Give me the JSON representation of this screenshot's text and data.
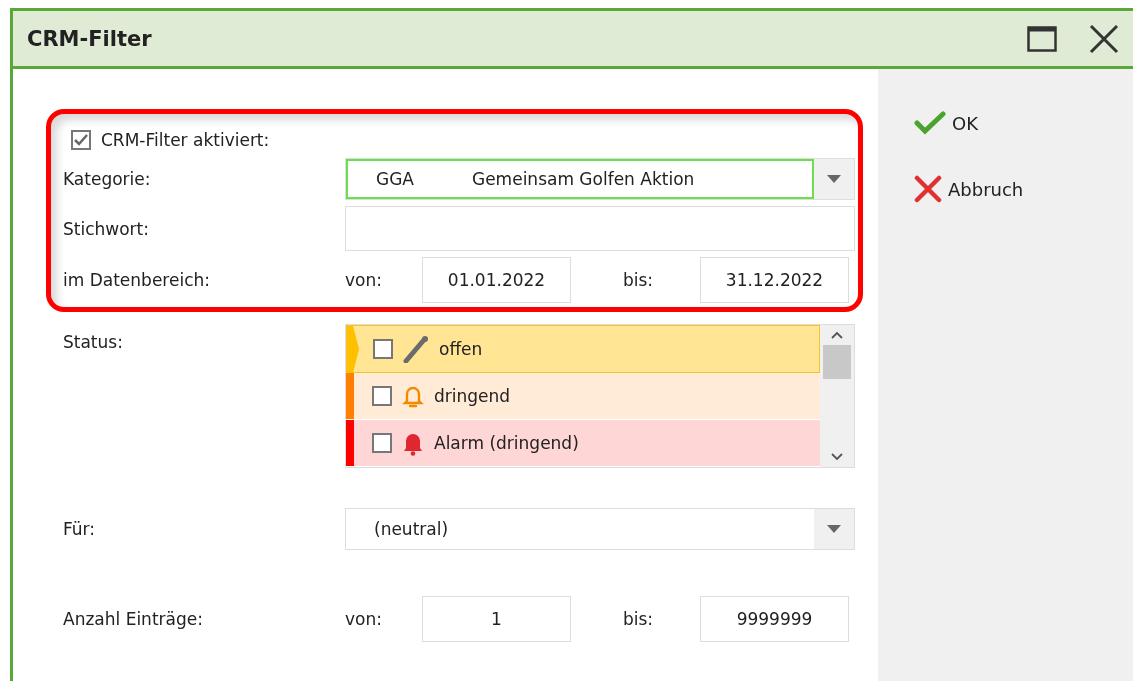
{
  "window": {
    "title": "CRM-Filter"
  },
  "filter_enabled": {
    "label": "CRM-Filter aktiviert:",
    "checked": true
  },
  "category": {
    "label": "Kategorie:",
    "code": "GGA",
    "value": "Gemeinsam Golfen Aktion"
  },
  "keyword": {
    "label": "Stichwort:"
  },
  "date_range": {
    "label": "im Datenbereich:",
    "from_label": "von:",
    "from": "01.01.2022",
    "to_label": "bis:",
    "to": "31.12.2022"
  },
  "status": {
    "label": "Status:",
    "items": [
      {
        "kind": "pencil",
        "label": "offen",
        "checked": false,
        "selected": true,
        "color": "#ffc000"
      },
      {
        "kind": "bell",
        "label": "dringend",
        "checked": false,
        "selected": false,
        "color": "#ff7f00"
      },
      {
        "kind": "alarm",
        "label": "Alarm (dringend)",
        "checked": false,
        "selected": false,
        "color": "#ff0000"
      }
    ]
  },
  "for": {
    "label": "Für:",
    "value": "(neutral)"
  },
  "entries": {
    "label": "Anzahl Einträge:",
    "from_label": "von:",
    "from": "1",
    "to_label": "bis:",
    "to": "9999999"
  },
  "buttons": [
    {
      "kind": "ok",
      "label": "OK"
    },
    {
      "kind": "cancel",
      "label": "Abbruch"
    }
  ]
}
